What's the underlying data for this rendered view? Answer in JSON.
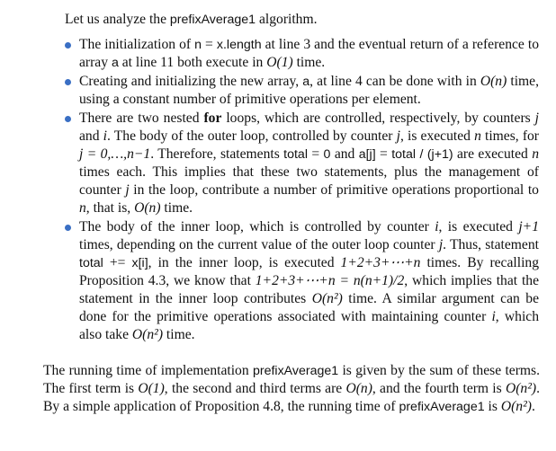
{
  "document": {
    "intro": {
      "prefix": "Let us analyze the ",
      "code": "prefixAverage1",
      "suffix": " algorithm."
    },
    "bullets": [
      {
        "p1": "The initialization of ",
        "c1": "n",
        "p2": " = ",
        "c2": "x.length",
        "p3": " at line 3 and the eventual return of a reference to array ",
        "c3": "a",
        "p4": " at line 11 both execute in ",
        "m1": "O(1)",
        "p5": " time."
      },
      {
        "p1": "Creating and initializing the new array, ",
        "c1": "a",
        "p2": ", at line 4 can be done with in ",
        "m1": "O(n)",
        "p3": " time, using a constant number of primitive operations per element."
      },
      {
        "p1": "There are two nested ",
        "b1": "for",
        "p2": " loops, which are controlled, respectively, by counters ",
        "m1": "j",
        "p3": " and ",
        "m2": "i",
        "p4": ". The body of the outer loop, controlled by counter ",
        "m3": "j",
        "p5": ", is executed ",
        "m4": "n",
        "p6": " times, for ",
        "m5": "j = 0,…,n−1",
        "p7": ". Therefore, statements ",
        "c1": "total",
        "p8": " = ",
        "c2": "0",
        "p9": " and ",
        "c3": "a[j]",
        "p10": " = ",
        "c4": "total / (j+1)",
        "p11": " are executed ",
        "m6": "n",
        "p12": " times each. This implies that these two statements, plus the management of counter ",
        "m7": "j",
        "p13": " in the loop, contribute a number of primitive operations proportional to ",
        "m8": "n",
        "p14": ", that is, ",
        "m9": "O(n)",
        "p15": " time."
      },
      {
        "p1": "The body of the inner loop, which is controlled by counter ",
        "m1": "i",
        "p2": ", is executed ",
        "m2": "j+1",
        "p3": " times, depending on the current value of the outer loop counter ",
        "m3": "j",
        "p4": ". Thus, statement ",
        "c1": "total",
        "p5": " += ",
        "c2": "x[i]",
        "p6": ", in the inner loop, is executed ",
        "m4": "1+2+3+⋯+n",
        "p7": " times. By recalling Proposition 4.3, we know that ",
        "m5": "1+2+3+⋯+n = n(n+1)/2",
        "p8": ", which implies that the statement in the inner loop contributes ",
        "m6": "O(n²)",
        "p9": " time. A similar argument can be done for the primitive operations associated with maintaining counter ",
        "m7": "i",
        "p10": ", which also take ",
        "m8": "O(n²)",
        "p11": " time."
      }
    ],
    "closing": {
      "p1": "The running time of implementation ",
      "c1": "prefixAverage1",
      "p2": " is given by the sum of these terms. The first term is ",
      "m1": "O(1)",
      "p3": ", the second and third terms are ",
      "m2": "O(n)",
      "p4": ", and the fourth term is ",
      "m3": "O(n²)",
      "p5": ". By a simple application of Proposition 4.8, the running time of ",
      "c2": "prefixAverage1",
      "p6": " is ",
      "m4": "O(n²)",
      "p7": "."
    }
  }
}
